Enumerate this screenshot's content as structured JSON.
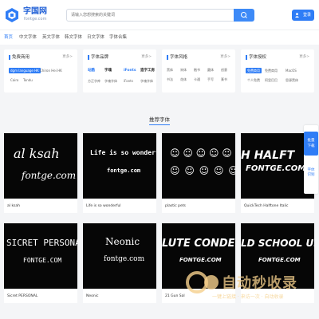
{
  "header": {
    "logo_text": "字国网",
    "logo_sub": "fontge.com",
    "search_placeholder": "请输入您想搜索的关键词",
    "login_label": "登录"
  },
  "nav": {
    "items": [
      "首页",
      "中文字体",
      "英文字体",
      "韩文字体",
      "日文字体",
      "字体合集"
    ]
  },
  "cards": [
    {
      "title": "免费商用",
      "more": "更多>",
      "tags": [
        "dgm language HK",
        "Chiron Hei HK",
        "Cairo",
        "Tondu"
      ]
    },
    {
      "title": "字体品牌",
      "more": "更多>",
      "tags": [
        "站酷",
        "字魂",
        "iFonts",
        "造字工房",
        "方正字库",
        "字魂字体",
        "iFonts",
        "字魂字体"
      ]
    },
    {
      "title": "字体风格",
      "more": "更多>",
      "tags": [
        "黑体",
        "宋体",
        "楷书",
        "圆体",
        "创意",
        "书法",
        "花体",
        "卡通",
        "手写",
        "篆书",
        "艺术",
        "漫画"
      ]
    },
    {
      "title": "字体授权",
      "more": "更多>",
      "tags": [
        "免费商用",
        "免费商用",
        "MacOS",
        "个人免费",
        "阿里巴巴",
        "思源黑体",
        "思源宋体",
        "免费字体"
      ]
    }
  ],
  "section": {
    "title": "推荐字体"
  },
  "fonts": [
    {
      "name": "al ksah",
      "preview1": "al ksah",
      "preview2": "fontge.com"
    },
    {
      "name": "Life is so wonderful",
      "preview1": "Life is so wonderful",
      "preview2": "fontge.com"
    },
    {
      "name": "plastic pets",
      "preview1": "☺ ☺ ☺ ☺ ☺ ☺",
      "preview2": ""
    },
    {
      "name": "QuickTech Halftone Italic",
      "preview1": "H HALFT",
      "preview2": "FONTGE.COM"
    },
    {
      "name": "Sicret PERSONAL",
      "preview1": "SICRET PERSONAL",
      "preview2": "FONTGE.COM"
    },
    {
      "name": "Neonic",
      "preview1": "Neonic",
      "preview2": "fontge.com"
    },
    {
      "name": "21 Gun Sal",
      "preview1": "LUTE CONDENS",
      "preview2": "FONTGE.COM"
    },
    {
      "name": "",
      "preview1": "LD SCHOOL UNITE",
      "preview2": "FONTGE.COM"
    }
  ],
  "side": {
    "primary": [
      "批量",
      "下载"
    ],
    "secondary": [
      "字体",
      "识别"
    ]
  },
  "watermark": {
    "text": "自动秒收录",
    "sub": "一键上链接 · 来访一次 · 自动收录"
  },
  "colors": {
    "accent": "#2f7df6",
    "tile_bg": "#060606"
  }
}
